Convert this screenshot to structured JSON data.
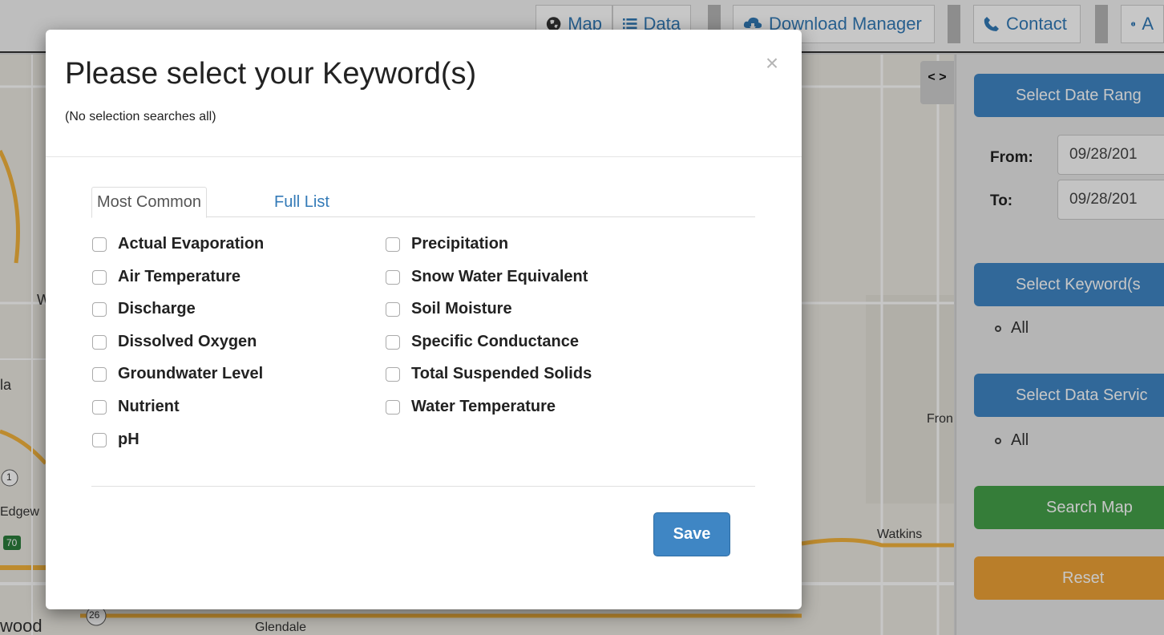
{
  "navbar": {
    "items": [
      {
        "label": "Map",
        "icon": "globe-icon"
      },
      {
        "label": "Data",
        "icon": "list-icon"
      },
      {
        "label": "Download Manager",
        "icon": "cloud-download-icon"
      },
      {
        "label": "Contact",
        "icon": "phone-icon"
      },
      {
        "label": "A",
        "icon": "info-icon"
      }
    ]
  },
  "map": {
    "toggle_label": "< >",
    "place_labels": [
      "W",
      "la",
      "Edgew",
      "wood",
      "Glendale",
      "Watkins",
      "Fron",
      "70",
      "26",
      "1"
    ]
  },
  "side_panel": {
    "select_date_label": "Select Date Rang",
    "from_label": "From:",
    "from_value": "09/28/201",
    "to_label": "To:",
    "to_value": "09/28/201",
    "select_keywords_label": "Select Keyword(s",
    "keywords_selected": "All",
    "select_data_services_label": "Select Data Servic",
    "data_services_selected": "All",
    "search_map_label": "Search Map",
    "reset_label": "Reset"
  },
  "modal": {
    "title": "Please select your Keyword(s)",
    "subtitle": "(No selection searches all)",
    "close_symbol": "×",
    "tabs": [
      {
        "label": "Most Common",
        "active": true
      },
      {
        "label": "Full List",
        "active": false
      }
    ],
    "keywords_col1": [
      "Actual Evaporation",
      "Air Temperature",
      "Discharge",
      "Dissolved Oxygen",
      "Groundwater Level",
      "Nutrient",
      "pH"
    ],
    "keywords_col2": [
      "Precipitation",
      "Snow Water Equivalent",
      "Soil Moisture",
      "Specific Conductance",
      "Total Suspended Solids",
      "Water Temperature"
    ],
    "save_label": "Save"
  },
  "colors": {
    "primary": "#3f86c4",
    "success": "#45a04a",
    "warning": "#eea236",
    "link": "#337ab7"
  }
}
